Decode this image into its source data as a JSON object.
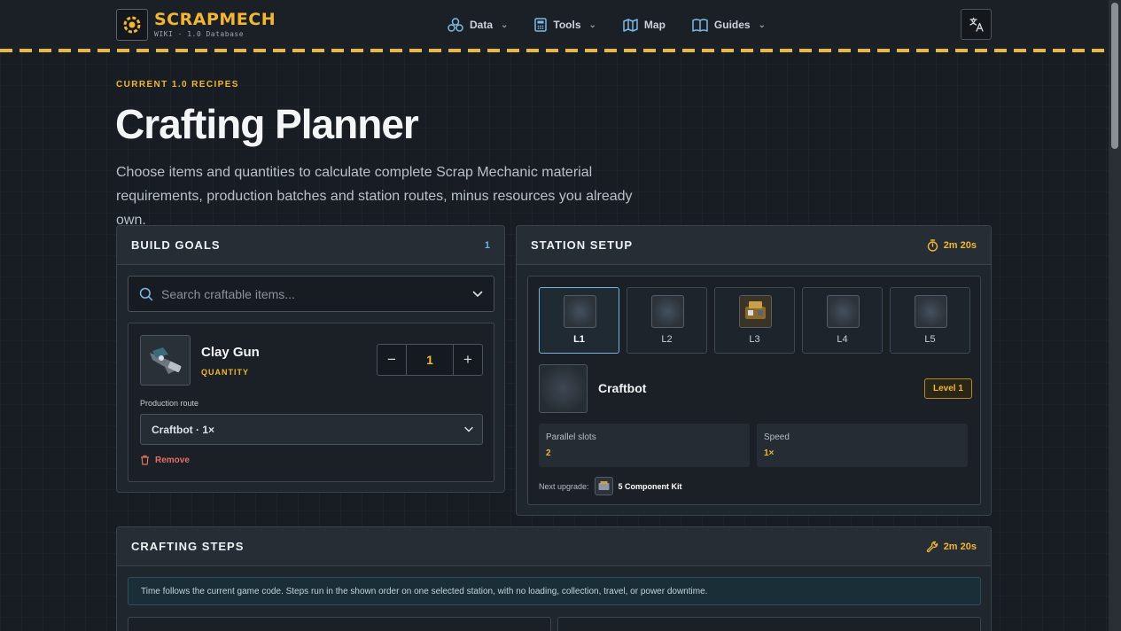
{
  "header": {
    "brand": "SCRAPMECH",
    "brand_sub": "WIKI · 1.0 Database",
    "nav": [
      {
        "label": "Data",
        "icon": "data-icon",
        "has_dropdown": true
      },
      {
        "label": "Tools",
        "icon": "calculator-icon",
        "has_dropdown": true
      },
      {
        "label": "Map",
        "icon": "map-icon",
        "has_dropdown": false
      },
      {
        "label": "Guides",
        "icon": "book-icon",
        "has_dropdown": true
      }
    ],
    "language_icon": "translate-icon"
  },
  "hero": {
    "eyebrow": "CURRENT 1.0 RECIPES",
    "title": "Crafting Planner",
    "description": "Choose items and quantities to calculate complete Scrap Mechanic material requirements, production batches and station routes, minus resources you already own."
  },
  "build_goals": {
    "title": "BUILD GOALS",
    "count": "1",
    "search_placeholder": "Search craftable items...",
    "item": {
      "name": "Clay Gun",
      "quantity_label": "QUANTITY",
      "quantity": "1",
      "route_label": "Production route",
      "route_value": "Craftbot · 1×",
      "remove_label": "Remove"
    }
  },
  "station_setup": {
    "title": "STATION SETUP",
    "time": "2m 20s",
    "levels": [
      {
        "label": "L1",
        "selected": true
      },
      {
        "label": "L2",
        "selected": false
      },
      {
        "label": "L3",
        "selected": false
      },
      {
        "label": "L4",
        "selected": false
      },
      {
        "label": "L5",
        "selected": false
      }
    ],
    "station_name": "Craftbot",
    "level_badge": "Level 1",
    "parallel_slots_label": "Parallel slots",
    "parallel_slots_value": "2",
    "speed_label": "Speed",
    "speed_value": "1×",
    "next_upgrade_label": "Next upgrade:",
    "next_upgrade_item": "5 Component Kit"
  },
  "crafting_steps": {
    "title": "CRAFTING STEPS",
    "time": "2m 20s",
    "notice": "Time follows the current game code. Steps run in the shown order on one selected station, with no loading, collection, travel, or power downtime."
  },
  "colors": {
    "accent": "#f2b632",
    "info": "#5fb8e6",
    "danger": "#e07064",
    "background": "#181d23"
  }
}
